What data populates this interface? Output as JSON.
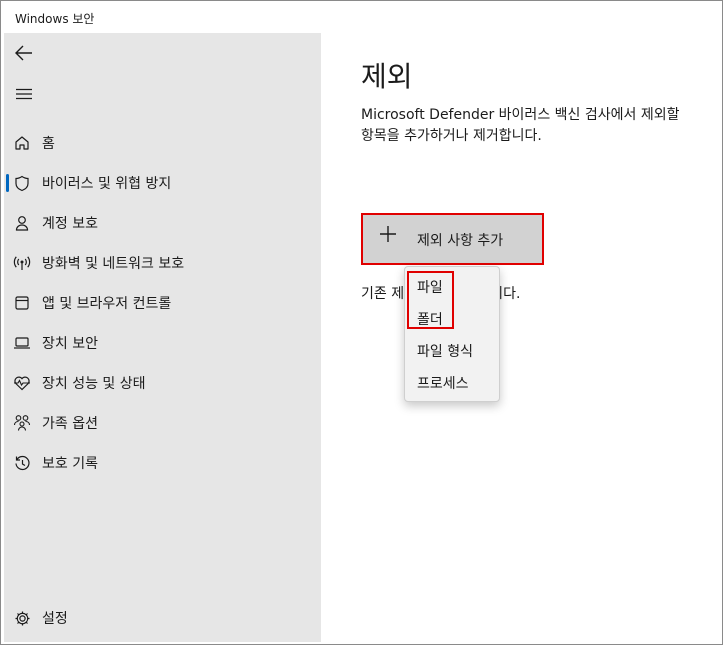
{
  "window": {
    "title": "Windows 보안"
  },
  "sidebar": {
    "items": [
      {
        "label": "홈",
        "icon": "home-icon"
      },
      {
        "label": "바이러스 및 위협 방지",
        "icon": "shield-icon",
        "selected": true
      },
      {
        "label": "계정 보호",
        "icon": "person-icon"
      },
      {
        "label": "방화벽 및 네트워크 보호",
        "icon": "wifi-antenna-icon"
      },
      {
        "label": "앱 및 브라우저 컨트롤",
        "icon": "app-window-icon"
      },
      {
        "label": "장치 보안",
        "icon": "laptop-icon"
      },
      {
        "label": "장치 성능 및 상태",
        "icon": "heartbeat-icon"
      },
      {
        "label": "가족 옵션",
        "icon": "family-icon"
      },
      {
        "label": "보호 기록",
        "icon": "history-icon"
      }
    ],
    "settings": {
      "label": "설정",
      "icon": "gear-icon"
    }
  },
  "main": {
    "title": "제외",
    "description": "Microsoft Defender 바이러스 백신 검사에서 제외할 항목을 추가하거나 제거합니다.",
    "add_button_label": "제외 사항 추가",
    "existing_text": "기존 제외 항목이 없습니다."
  },
  "dropdown": {
    "items": [
      "파일",
      "폴더",
      "파일 형식",
      "프로세스"
    ]
  },
  "colors": {
    "sidebar_bg": "#e6e6e6",
    "accent": "#0067c0",
    "highlight": "#e00000",
    "button_bg": "#d2d2d2"
  }
}
